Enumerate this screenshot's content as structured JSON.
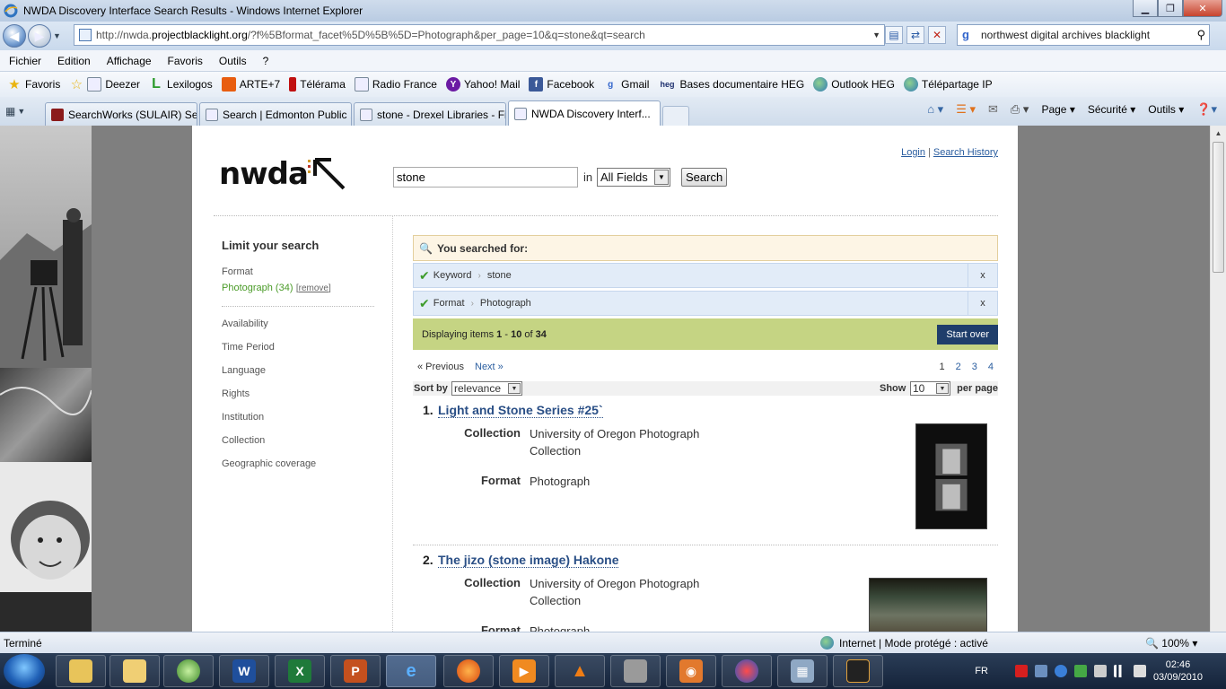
{
  "window": {
    "title": "NWDA Discovery Interface Search Results - Windows Internet Explorer"
  },
  "address": {
    "url_prefix": "http://nwda.",
    "url_domain": "projectblacklight.org",
    "url_rest": "/?f%5Bformat_facet%5D%5B%5D=Photograph&per_page=10&q=stone&qt=search",
    "search_engine_query": "northwest digital archives blacklight"
  },
  "menu": [
    "Fichier",
    "Edition",
    "Affichage",
    "Favoris",
    "Outils",
    "?"
  ],
  "favorites": {
    "label": "Favoris",
    "items": [
      "Deezer",
      "Lexilogos",
      "ARTE+7",
      "Télérama",
      "Radio France",
      "Yahoo! Mail",
      "Facebook",
      "Gmail",
      "Bases documentaire HEG",
      "Outlook HEG",
      "Télépartage IP"
    ]
  },
  "tabs": [
    {
      "label": "SearchWorks (SULAIR) Sea..."
    },
    {
      "label": "Search | Edmonton Public ..."
    },
    {
      "label": "stone - Drexel Libraries - Fi..."
    },
    {
      "label": "NWDA Discovery Interf..."
    }
  ],
  "commandbar": {
    "page": "Page",
    "security": "Sécurité",
    "tools": "Outils"
  },
  "site": {
    "logo_text": "nwda",
    "login": "Login",
    "search_history": "Search History",
    "query": "stone",
    "in_label": "in",
    "field": "All Fields",
    "search_button": "Search"
  },
  "sidebar": {
    "heading": "Limit your search",
    "format_label": "Format",
    "selected_facet": "Photograph (34)",
    "remove_label": "remove",
    "facets": [
      "Availability",
      "Time Period",
      "Language",
      "Rights",
      "Institution",
      "Collection",
      "Geographic coverage"
    ]
  },
  "constraints": {
    "heading": "You searched for:",
    "items": [
      {
        "field": "Keyword",
        "value": "stone",
        "remove": "x"
      },
      {
        "field": "Format",
        "value": "Photograph",
        "remove": "x"
      }
    ]
  },
  "summary": {
    "prefix": "Displaying items",
    "start": "1",
    "dash": "-",
    "end": "10",
    "of": "of",
    "total": "34",
    "start_over": "Start over"
  },
  "pager": {
    "previous": "« Previous",
    "next": "Next »",
    "pages": [
      "1",
      "2",
      "3",
      "4"
    ]
  },
  "sort": {
    "label": "Sort by",
    "value": "relevance",
    "show_label": "Show",
    "per_page": "10",
    "per_page_label": "per page"
  },
  "results": [
    {
      "num": "1.",
      "title": "Light and Stone Series #25`",
      "collection_label": "Collection",
      "collection": "University of Oregon Photograph Collection",
      "format_label": "Format",
      "format": "Photograph"
    },
    {
      "num": "2.",
      "title": "The jizo (stone image) Hakone",
      "collection_label": "Collection",
      "collection": "University of Oregon Photograph Collection",
      "format_label": "Format",
      "format": "Photograph"
    }
  ],
  "status": {
    "left": "Terminé",
    "zone": "Internet | Mode protégé : activé",
    "zoom": "100%"
  },
  "taskbar": {
    "lang": "FR",
    "time": "02:46",
    "date": "03/09/2010"
  }
}
